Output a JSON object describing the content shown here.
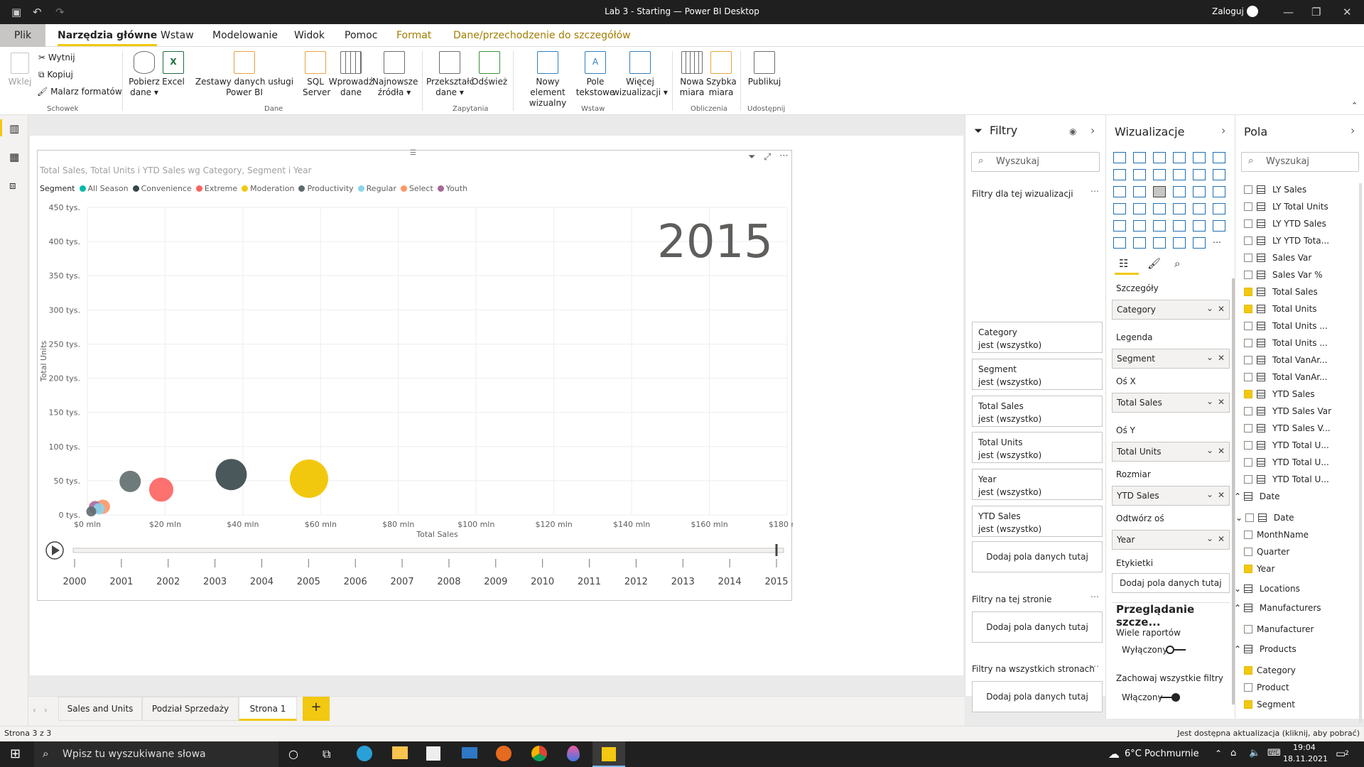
{
  "window": {
    "title": "Lab 3 - Starting — Power BI Desktop",
    "login": "Zaloguj"
  },
  "menu": {
    "file": "Plik",
    "tabs": [
      "Narzędzia główne",
      "Wstaw",
      "Modelowanie",
      "Widok",
      "Pomoc",
      "Format",
      "Dane/przechodzenie do szczegółów"
    ]
  },
  "ribbon": {
    "paste": "Wklej",
    "cut": "Wytnij",
    "copy": "Kopiuj",
    "format_painter": "Malarz formatów",
    "clipboard_group": "Schowek",
    "get_data": "Pobierz dane",
    "excel": "Excel",
    "datasets": "Zestawy danych usługi Power BI",
    "sql": "SQL Server",
    "enter_data": "Wprowadź dane",
    "recent": "Najnowsze źródła",
    "data_group": "Dane",
    "transform": "Przekształć dane",
    "refresh": "Odśwież",
    "queries_group": "Zapytania",
    "new_visual": "Nowy element wizualny",
    "textbox": "Pole tekstowe",
    "more_visuals": "Więcej wizualizacji",
    "insert_group": "Wstaw",
    "new_measure": "Nowa miara",
    "quick_measure": "Szybka miara",
    "calc_group": "Obliczenia",
    "publish": "Publikuj",
    "share_group": "Udostępnij"
  },
  "visual_title": "Total Sales, Total Units i YTD Sales wg Category, Segment i Year",
  "chart_data": {
    "type": "scatter",
    "title": "Total Sales, Total Units i YTD Sales wg Category, Segment i Year",
    "xlabel": "Total Sales",
    "ylabel": "Total Units",
    "xlim": [
      0,
      180
    ],
    "ylim": [
      0,
      450
    ],
    "x_ticks": [
      "$0 mln",
      "$20 mln",
      "$40 mln",
      "$60 mln",
      "$80 mln",
      "$100 mln",
      "$120 mln",
      "$140 mln",
      "$160 mln",
      "$180 mln"
    ],
    "y_ticks": [
      "0 tys.",
      "50 tys.",
      "100 tys.",
      "150 tys.",
      "200 tys.",
      "250 tys.",
      "300 tys.",
      "350 tys.",
      "400 tys.",
      "450 tys."
    ],
    "legend_title": "Segment",
    "legend": [
      {
        "name": "All Season",
        "color": "#01b8aa"
      },
      {
        "name": "Convenience",
        "color": "#374649"
      },
      {
        "name": "Extreme",
        "color": "#fd625e"
      },
      {
        "name": "Moderation",
        "color": "#f2c80f"
      },
      {
        "name": "Productivity",
        "color": "#5f6b6d"
      },
      {
        "name": "Regular",
        "color": "#8ad4eb"
      },
      {
        "name": "Select",
        "color": "#fe9666"
      },
      {
        "name": "Youth",
        "color": "#a66999"
      }
    ],
    "play_year": "2015",
    "points": [
      {
        "segment": "Productivity",
        "x": 11,
        "y": 49,
        "r": 15
      },
      {
        "segment": "Extreme",
        "x": 19,
        "y": 37,
        "r": 17
      },
      {
        "segment": "Convenience",
        "x": 37,
        "y": 59,
        "r": 22
      },
      {
        "segment": "Moderation",
        "x": 57,
        "y": 53,
        "r": 27
      },
      {
        "segment": "Select",
        "x": 4,
        "y": 12,
        "r": 10
      },
      {
        "segment": "Youth",
        "x": 2,
        "y": 11,
        "r": 9
      },
      {
        "segment": "Regular",
        "x": 3,
        "y": 9,
        "r": 8
      },
      {
        "segment": "Productivity",
        "x": 1,
        "y": 5,
        "r": 7
      }
    ],
    "years": [
      "2000",
      "2001",
      "2002",
      "2003",
      "2004",
      "2005",
      "2006",
      "2007",
      "2008",
      "2009",
      "2010",
      "2011",
      "2012",
      "2013",
      "2014",
      "2015"
    ]
  },
  "filters": {
    "title": "Filtry",
    "search": "Wyszukaj",
    "visual_section": "Filtry dla tej wizualizacji",
    "cards": [
      {
        "name": "Category",
        "state": "jest (wszystko)"
      },
      {
        "name": "Segment",
        "state": "jest (wszystko)"
      },
      {
        "name": "Total Sales",
        "state": "jest (wszystko)"
      },
      {
        "name": "Total Units",
        "state": "jest (wszystko)"
      },
      {
        "name": "Year",
        "state": "jest (wszystko)"
      },
      {
        "name": "YTD Sales",
        "state": "jest (wszystko)"
      }
    ],
    "add": "Dodaj pola danych tutaj",
    "page_section": "Filtry na tej stronie",
    "all_section": "Filtry na wszystkich stronach"
  },
  "viz": {
    "title": "Wizualizacje",
    "details": "Szczegóły",
    "details_val": "Category",
    "legend": "Legenda",
    "legend_val": "Segment",
    "x": "Oś X",
    "x_val": "Total Sales",
    "y": "Oś Y",
    "y_val": "Total Units",
    "size": "Rozmiar",
    "size_val": "YTD Sales",
    "play": "Odtwórz oś",
    "play_val": "Year",
    "labels": "Etykietki",
    "labels_add": "Dodaj pola danych tutaj",
    "drill": "Przeglądanie szcze...",
    "cross": "Wiele raportów",
    "cross_val": "Wyłączony",
    "keep": "Zachowaj wszystkie filtry",
    "keep_val": "Włączony"
  },
  "fields": {
    "title": "Pola",
    "search": "Wyszukaj",
    "measures": [
      {
        "name": "LY Sales",
        "on": false
      },
      {
        "name": "LY Total Units",
        "on": false
      },
      {
        "name": "LY YTD Sales",
        "on": false
      },
      {
        "name": "LY YTD Tota...",
        "on": false
      },
      {
        "name": "Sales Var",
        "on": false
      },
      {
        "name": "Sales Var %",
        "on": false
      },
      {
        "name": "Total Sales",
        "on": true
      },
      {
        "name": "Total Units",
        "on": true
      },
      {
        "name": "Total Units ...",
        "on": false
      },
      {
        "name": "Total Units ...",
        "on": false
      },
      {
        "name": "Total VanAr...",
        "on": false
      },
      {
        "name": "Total VanAr...",
        "on": false
      },
      {
        "name": "YTD Sales",
        "on": true
      },
      {
        "name": "YTD Sales Var",
        "on": false
      },
      {
        "name": "YTD Sales V...",
        "on": false
      },
      {
        "name": "YTD Total U...",
        "on": false
      },
      {
        "name": "YTD Total U...",
        "on": false
      },
      {
        "name": "YTD Total U...",
        "on": false
      }
    ],
    "date_table": "Date",
    "date_hier": "Date",
    "date_items": [
      {
        "name": "MonthName",
        "on": false
      },
      {
        "name": "Quarter",
        "on": false
      },
      {
        "name": "Year",
        "on": true
      }
    ],
    "locations": "Locations",
    "manufacturers": "Manufacturers",
    "manufacturer": "Manufacturer",
    "products": "Products",
    "product_items": [
      {
        "name": "Category",
        "on": true
      },
      {
        "name": "Product",
        "on": false
      },
      {
        "name": "Segment",
        "on": true
      }
    ]
  },
  "pages": {
    "tabs": [
      "Sales and Units",
      "Podział Sprzedaży",
      "Strona 1"
    ],
    "active": "Strona 1"
  },
  "status": {
    "left": "Strona 3 z 3",
    "right": "Jest dostępna aktualizacja (kliknij, aby pobrać)"
  },
  "taskbar": {
    "search": "Wpisz tu wyszukiwane słowa",
    "weather": "6°C Pochmurnie",
    "time": "19:04",
    "date": "18.11.2021",
    "notif": "2"
  }
}
